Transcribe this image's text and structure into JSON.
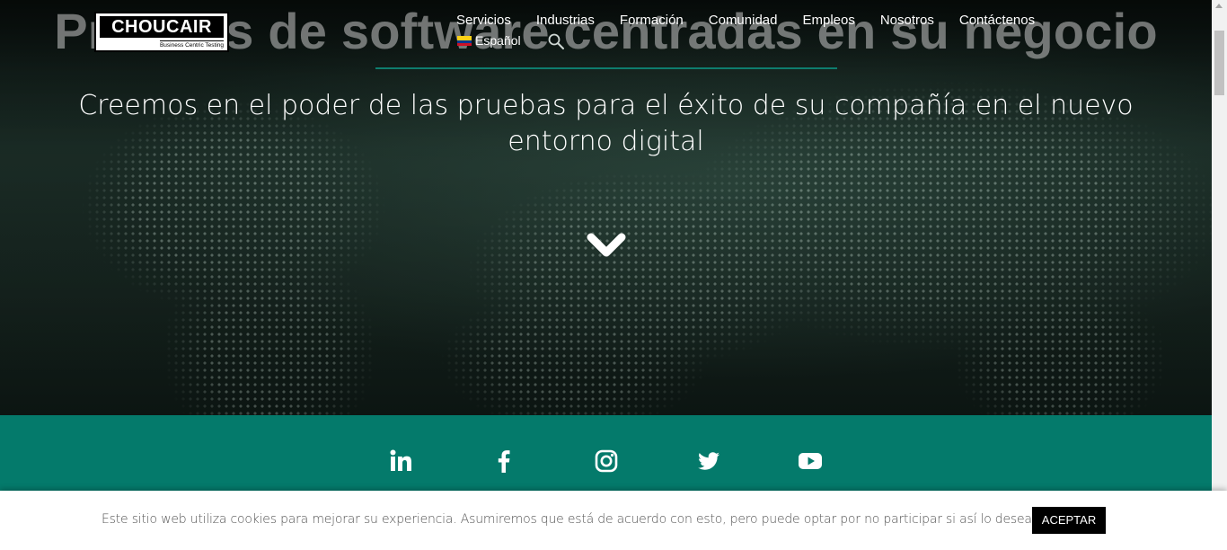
{
  "hero": {
    "title": "Pruebas de software centradas en su negocio",
    "subtitle": "Creemos en el poder de las pruebas para el éxito de su compañía en el nuevo entorno digital"
  },
  "logo": {
    "name": "CHOUCAIR",
    "tagline": "Business Centric Testing"
  },
  "nav": {
    "items": [
      {
        "label": "Servicios"
      },
      {
        "label": "Industrias"
      },
      {
        "label": "Formación"
      },
      {
        "label": "Comunidad"
      },
      {
        "label": "Empleos"
      },
      {
        "label": "Nosotros"
      },
      {
        "label": "Contáctenos"
      }
    ],
    "language": "Español"
  },
  "social": [
    {
      "icon": "linkedin-icon"
    },
    {
      "icon": "facebook-icon"
    },
    {
      "icon": "instagram-icon"
    },
    {
      "icon": "twitter-icon"
    },
    {
      "icon": "youtube-icon"
    }
  ],
  "cookie": {
    "text": "Este sitio web utiliza cookies para mejorar su experiencia. Asumiremos que está de acuerdo con esto, pero puede optar por no participar si así lo desea.",
    "accept_label": "ACEPTAR"
  },
  "colors": {
    "brand_teal": "#047a6b",
    "accent_rule": "#0e7d6e"
  }
}
